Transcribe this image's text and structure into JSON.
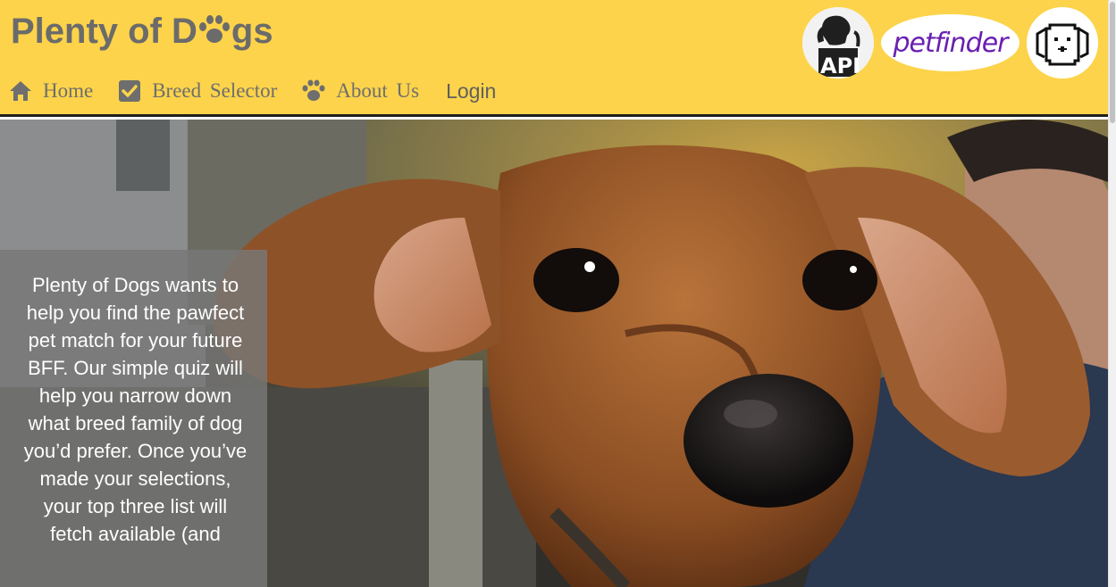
{
  "brand": {
    "title_part1": "Plenty of D",
    "title_part2": "gs"
  },
  "nav": {
    "items": [
      {
        "label": "Home",
        "icon": "home-icon"
      },
      {
        "label": "Breed Selector",
        "icon": "checkbox-icon"
      },
      {
        "label": "About Us",
        "icon": "paw-icon"
      }
    ],
    "login_label": "Login"
  },
  "logos": {
    "api_label": "API",
    "petfinder_label": "petfinder"
  },
  "intro": {
    "text": "Plenty of Dogs wants to help you find the pawfect pet match for your future BFF. Our simple quiz will help you narrow down what breed family of dog you’d prefer. Once you’ve made your selections, your top three list will fetch available (and"
  },
  "colors": {
    "header_bg": "#fcd34a",
    "brand_text": "#6b6b6b",
    "petfinder_purple": "#6a1fb1"
  }
}
